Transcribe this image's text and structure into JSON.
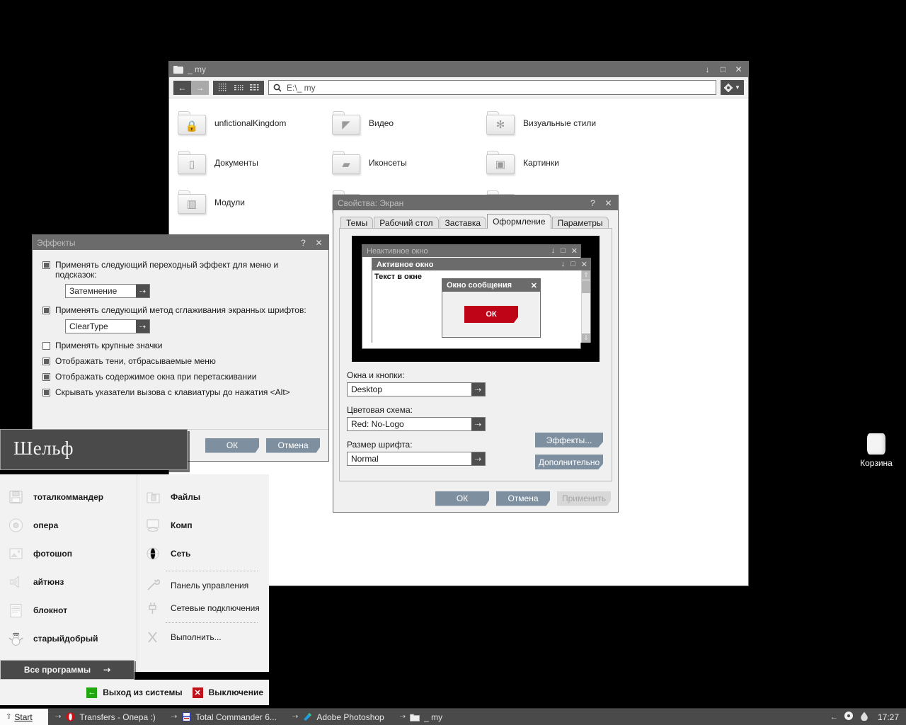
{
  "desktop": {
    "background_color": "#000000",
    "recycle_bin": {
      "label": "Корзина",
      "icon": "recycle-bin-icon"
    }
  },
  "explorer": {
    "title": "_ my",
    "title_icon": "folder-icon",
    "window_controls": {
      "minimize": "↓",
      "maximize": "□",
      "close": "✕"
    },
    "toolbar": {
      "back": "←",
      "forward": "→",
      "views": [
        "view-icons-icon",
        "view-list-icon",
        "view-details-icon"
      ],
      "gear": "gear-icon",
      "gear_arrow": "▼"
    },
    "address": {
      "search_icon": "search-icon",
      "path": "E:\\_ my"
    },
    "items": [
      {
        "label": "unfictionalKingdom",
        "icon": "lock-icon",
        "glyph": "🔒"
      },
      {
        "label": "Видео",
        "icon": "video-icon",
        "glyph": "🎬"
      },
      {
        "label": "Визуальные стили",
        "icon": "gear-icon",
        "glyph": "⚙"
      },
      {
        "label": "Документы",
        "icon": "document-icon",
        "glyph": "📄"
      },
      {
        "label": "Иконсеты",
        "icon": "iconset-icon",
        "glyph": "▦"
      },
      {
        "label": "Картинки",
        "icon": "picture-icon",
        "glyph": "🖼"
      },
      {
        "label": "Модули",
        "icon": "modules-icon",
        "glyph": "▥"
      },
      {
        "label": "",
        "icon": "folder-icon",
        "glyph": ""
      },
      {
        "label": "",
        "icon": "folder-icon",
        "glyph": ""
      }
    ]
  },
  "effects_dialog": {
    "title": "Эффекты",
    "help_btn": "?",
    "close_btn": "✕",
    "checkboxes": [
      {
        "label": "Применять следующий переходный эффект для меню и подсказок:",
        "checked": true
      },
      {
        "label": "Применять следующий метод сглаживания экранных шрифтов:",
        "checked": true
      },
      {
        "label": "Применять крупные значки",
        "checked": false
      },
      {
        "label": "Отображать тени, отбрасываемые меню",
        "checked": true
      },
      {
        "label": "Отображать содержимое окна при перетаскивании",
        "checked": true
      },
      {
        "label": "Скрывать указатели вызова с клавиатуры до нажатия <Alt>",
        "checked": true
      }
    ],
    "combo_transition": {
      "value": "Затемнение",
      "arrow": "⇢"
    },
    "combo_smoothing": {
      "value": "ClearType",
      "arrow": "⇢"
    },
    "buttons": {
      "ok": "ОК",
      "cancel": "Отмена"
    }
  },
  "display_properties": {
    "title": "Свойства: Экран",
    "help_btn": "?",
    "close_btn": "✕",
    "tabs": [
      {
        "label": "Темы",
        "active": false
      },
      {
        "label": "Рабочий стол",
        "active": false
      },
      {
        "label": "Заставка",
        "active": false
      },
      {
        "label": "Оформление",
        "active": true
      },
      {
        "label": "Параметры",
        "active": false
      }
    ],
    "preview": {
      "inactive_window_title": "Неактивное окно",
      "active_window_title": "Активное окно",
      "window_text": "Текст в окне",
      "message_box_title": "Окно сообщения",
      "message_box_button": "ОК",
      "message_box_button_color": "#c00418",
      "window_controls": {
        "minimize": "↓",
        "maximize": "□",
        "close": "✕"
      },
      "scroll_up": "⇧",
      "scroll_down": "⇩"
    },
    "fields": [
      {
        "label": "Окна и кнопки:",
        "value": "Desktop",
        "arrow": "⇢"
      },
      {
        "label": "Цветовая схема:",
        "value": "Red: No-Logo",
        "arrow": "⇢"
      },
      {
        "label": "Размер шрифта:",
        "value": "Normal",
        "arrow": "⇢"
      }
    ],
    "side_buttons": {
      "effects": "Эффекты...",
      "advanced": "Дополнительно"
    },
    "footer_buttons": {
      "ok": "ОК",
      "cancel": "Отмена",
      "apply": "Применить",
      "apply_disabled": true
    }
  },
  "start_menu": {
    "user_name": "Шельф",
    "left_items": [
      {
        "label": "тоталкоммандер",
        "icon": "floppy-disk-icon",
        "glyph": "▣"
      },
      {
        "label": "опера",
        "icon": "disc-icon",
        "glyph": "◎"
      },
      {
        "label": "фотошоп",
        "icon": "image-icon",
        "glyph": "▤"
      },
      {
        "label": "айтюнз",
        "icon": "speaker-icon",
        "glyph": "◍"
      },
      {
        "label": "блокнот",
        "icon": "notepad-icon",
        "glyph": "▤"
      },
      {
        "label": "старыйдобрый",
        "icon": "snowman-icon",
        "glyph": "☃"
      }
    ],
    "right_items": [
      {
        "label": "Файлы",
        "icon": "folder-icon",
        "glyph": "▯",
        "bold": true,
        "separator_after": false
      },
      {
        "label": "Комп",
        "icon": "computer-icon",
        "glyph": "▭",
        "bold": true,
        "separator_after": false
      },
      {
        "label": "Сеть",
        "icon": "network-icon",
        "glyph": "◍",
        "bold": true,
        "separator_after": true
      },
      {
        "label": "Панель управления",
        "icon": "wrench-icon",
        "glyph": "⌇",
        "bold": false,
        "separator_after": false
      },
      {
        "label": "Сетевые подключения",
        "icon": "plug-icon",
        "glyph": "⊥",
        "bold": false,
        "separator_after": true
      },
      {
        "label": "Выполнить...",
        "icon": "run-icon",
        "glyph": "✕",
        "bold": false,
        "separator_after": false
      }
    ],
    "all_programs": {
      "label": "Все программы",
      "arrow": "⇢"
    },
    "logoff": {
      "label": "Выход из системы",
      "icon": "logoff-icon",
      "glyph": "←",
      "color": "#22a80f"
    },
    "shutdown": {
      "label": "Выключение",
      "icon": "shutdown-icon",
      "glyph": "✕",
      "color": "#c0121a"
    }
  },
  "taskbar": {
    "start_button": {
      "label": "Start",
      "arrow": "⇧"
    },
    "tasks": [
      {
        "label": "Transfers - Опера :)",
        "icon": "opera-icon",
        "arrow": "⇢"
      },
      {
        "label": "Total Commander 6...",
        "icon": "totalcmd-icon",
        "arrow": "⇢"
      },
      {
        "label": "Adobe Photoshop",
        "icon": "photoshop-icon",
        "arrow": "⇢"
      },
      {
        "label": "_ my",
        "icon": "folder-icon",
        "arrow": "⇢"
      }
    ],
    "tray": {
      "icons": [
        "show-hidden-icons-icon",
        "disc-icon",
        "droplet-icon"
      ],
      "glyphs": [
        "←",
        "◉",
        "◓"
      ],
      "clock": "17:27"
    }
  }
}
